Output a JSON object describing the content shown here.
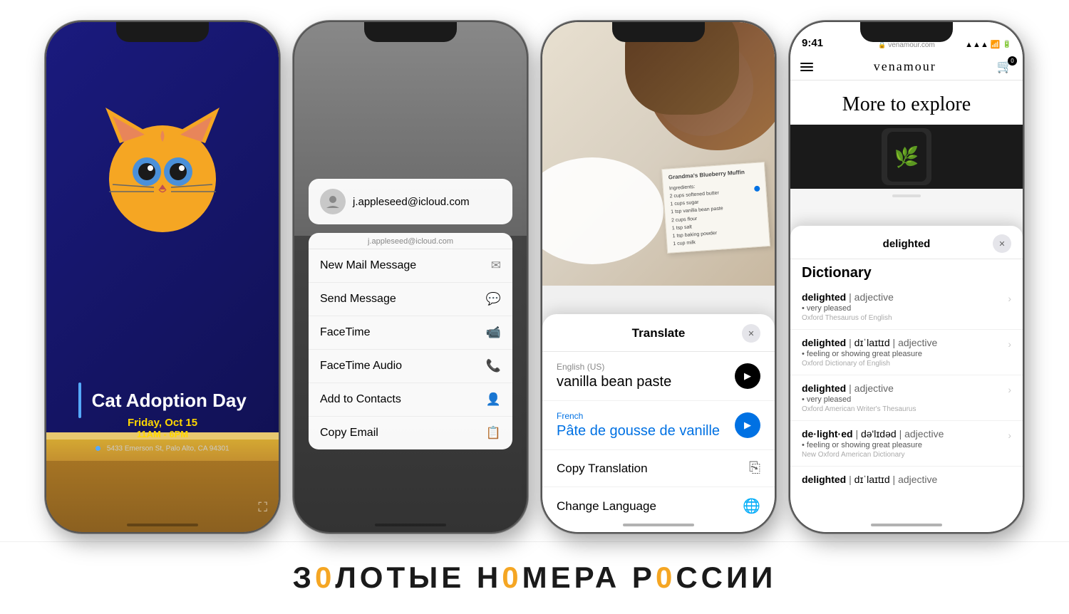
{
  "page": {
    "background": "#ffffff"
  },
  "phone1": {
    "event_title": "Cat Adoption Day",
    "event_day": "Friday, Oct 15",
    "event_time": "11AM - 6PM",
    "event_address": "5433 Emerson St, Palo Alto, CA 94301"
  },
  "phone2": {
    "email": "j.appleseed@icloud.com",
    "menu_label": "j.appleseed@icloud.com",
    "menu_items": [
      {
        "label": "New Mail Message",
        "icon": "✉"
      },
      {
        "label": "Send Message",
        "icon": "💬"
      },
      {
        "label": "FaceTime",
        "icon": "📹"
      },
      {
        "label": "FaceTime Audio",
        "icon": "📞"
      },
      {
        "label": "Add to Contacts",
        "icon": "👤"
      },
      {
        "label": "Copy Email",
        "icon": "📋"
      }
    ]
  },
  "phone3": {
    "panel_title": "Translate",
    "source_lang": "English (US)",
    "source_text": "vanilla bean paste",
    "target_lang": "French",
    "target_text": "Pâte de gousse de vanille",
    "action1": "Copy Translation",
    "action2": "Change Language",
    "recipe_title": "Grandma's Blueberry Muffin",
    "recipe_ingredients": "Ingredients:\n2 cups softened butter\n1 cups sugar\n1 tsp vanilla bean paste\n2 cups flour\n1 tsp salt\n1 tsp baking powder\n1 cup milk"
  },
  "phone4": {
    "status_time": "9:41",
    "website": "venamour.com",
    "brand": "venamour",
    "explore_title": "More to explore",
    "dict_panel_word": "delighted",
    "dict_section": "Dictionary",
    "entries": [
      {
        "word": "delighted",
        "phonetic": "",
        "type": "adjective",
        "def": "• very pleased",
        "source": "Oxford Thesaurus of English"
      },
      {
        "word": "delighted",
        "phonetic": "dɪˈlaɪtɪd",
        "type": "adjective",
        "def": "• feeling or showing great pleasure",
        "source": "Oxford Dictionary of English"
      },
      {
        "word": "delighted",
        "phonetic": "",
        "type": "adjective",
        "def": "• very pleased",
        "source": "Oxford American Writer's Thesaurus"
      },
      {
        "word": "de·light·ed",
        "phonetic": "də'lɪdəd",
        "type": "adjective",
        "def": "• feeling or showing great pleasure",
        "source": "New Oxford American Dictionary"
      },
      {
        "word": "delighted",
        "phonetic": "dɪˈlaɪtɪd",
        "type": "adjective",
        "def": "",
        "source": ""
      }
    ]
  },
  "banner": {
    "text_parts": [
      "З",
      "0",
      "Л",
      "О",
      "Т",
      "Ы",
      "Е",
      " ",
      "Н",
      "0",
      "М",
      "Е",
      "Р",
      "А",
      " ",
      "Р",
      "0",
      "С",
      "С",
      "И",
      "И"
    ]
  }
}
